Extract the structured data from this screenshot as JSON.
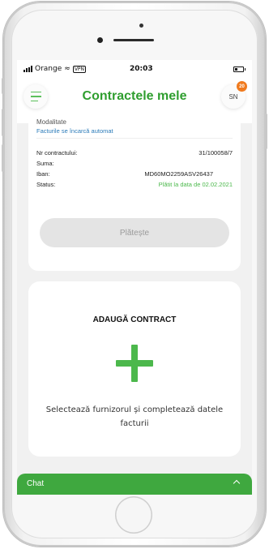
{
  "status_bar": {
    "carrier": "Orange",
    "vpn": "VPN",
    "time": "20:03"
  },
  "header": {
    "title": "Contractele mele",
    "avatar_initials": "SN",
    "notification_count": "20"
  },
  "contract": {
    "partial_label": "Modalitate",
    "auto_note": "Facturile se încarcă automat",
    "rows": [
      {
        "label": "Nr contractului:",
        "value": "31/100058/7"
      },
      {
        "label": "Suma:",
        "value": ""
      },
      {
        "label": "Iban:",
        "value": "MD60MO2259ASV26437"
      },
      {
        "label": "Status:",
        "value": "Plătit la data de 02.02.2021"
      }
    ],
    "pay_button": "Plătește"
  },
  "add_contract": {
    "title": "ADAUGĂ CONTRACT",
    "description": "Selectează furnizorul și completează datele facturii"
  },
  "chat": {
    "label": "Chat"
  },
  "colors": {
    "accent_green": "#2f9e2f",
    "status_green": "#4bb84b",
    "chat_green": "#3fa83f",
    "badge_orange": "#f07a1e",
    "link_blue": "#2b7bb9"
  }
}
